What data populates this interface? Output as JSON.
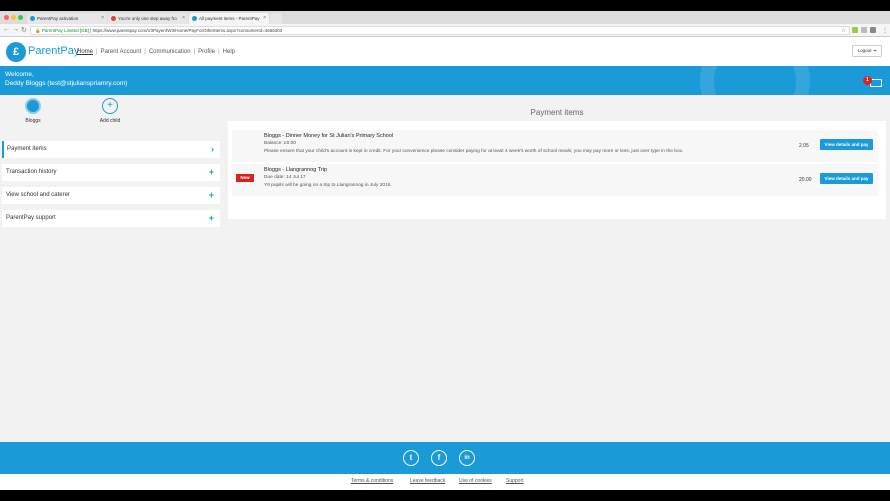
{
  "browser": {
    "tabs": [
      {
        "label": "ParentPay activation",
        "favicon_color": "#1a9ad7"
      },
      {
        "label": "You're only one step away fro",
        "favicon_color": "#d44638"
      },
      {
        "label": "All payment items - ParentPay",
        "favicon_color": "#1a9ad7"
      }
    ],
    "secure_label": "ParentPay Limited [GB]",
    "url": "https://www.parentpay.com/V3Payer4W3/Home/PayForOtherItems.aspx?consumerId=4666303"
  },
  "header": {
    "logo_text": "ParentPay",
    "nav": [
      "Home",
      "Parent Account",
      "Communication",
      "Profile",
      "Help"
    ],
    "logout_label": "Logout"
  },
  "banner": {
    "welcome": "Welcome,",
    "user": "Deddy Bloggs (test@stjulianspriamry.com)",
    "cart_count": "1"
  },
  "children": [
    {
      "label": "Bloggs"
    },
    {
      "label": "Add child"
    }
  ],
  "menu": [
    {
      "label": "Payment items",
      "icon": "chevron-right-icon",
      "glyph": "›"
    },
    {
      "label": "Transaction history",
      "icon": "plus-icon",
      "glyph": "+"
    },
    {
      "label": "View school and caterer",
      "icon": "plus-icon",
      "glyph": "+"
    },
    {
      "label": "ParentPay support",
      "icon": "plus-icon",
      "glyph": "+"
    }
  ],
  "main": {
    "title": "Payment items",
    "items": [
      {
        "title": "Bloggs - Dinner Money for St Julian's Primary School",
        "line1": "Balance: £0.00",
        "line2": "Please ensure that your child's account is kept in credit. For your convenience please consider paying for at least 4 week's worth of school meals; you may pay more or less, just over type in the box.",
        "amount": "2.05",
        "button": "View details and pay",
        "badge": ""
      },
      {
        "title": "Bloggs - Llangrannog Trip",
        "line1": "Due date: 14 Jul 17",
        "line2": "Y6 pupils will be going on a trip to Llangrannog in July 2016.",
        "amount": "20.00",
        "button": "View details and pay",
        "badge": "New"
      }
    ]
  },
  "footer": {
    "social": [
      {
        "name": "twitter-icon",
        "glyph": "t"
      },
      {
        "name": "facebook-icon",
        "glyph": "f"
      },
      {
        "name": "linkedin-icon",
        "glyph": "in"
      }
    ],
    "links": [
      "Terms & conditions",
      "Leave feedback",
      "Use of cookies",
      "Support"
    ]
  },
  "colors": {
    "brand": "#1a9ad7",
    "new_badge": "#d9211d"
  }
}
